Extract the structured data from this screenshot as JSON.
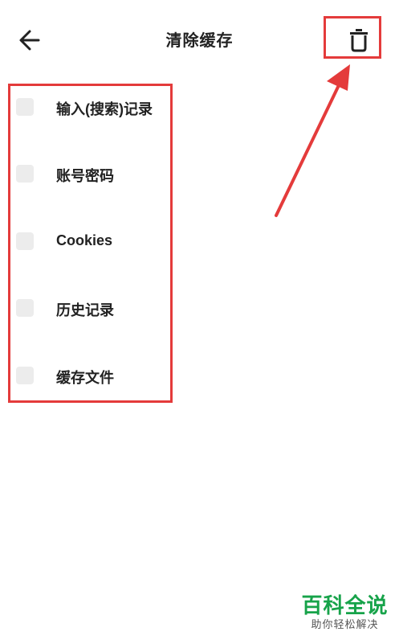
{
  "header": {
    "back_icon": "arrow-left-icon",
    "title": "清除缓存",
    "trash_icon": "trash-icon"
  },
  "list": {
    "items": [
      {
        "label": "输入(搜索)记录",
        "checked": false
      },
      {
        "label": "账号密码",
        "checked": false
      },
      {
        "label": "Cookies",
        "checked": false
      },
      {
        "label": "历史记录",
        "checked": false
      },
      {
        "label": "缓存文件",
        "checked": false
      }
    ]
  },
  "annotation": {
    "color": "#e43b3b"
  },
  "watermark": {
    "main": "百科全说",
    "sub": "助你轻松解决",
    "color": "#17a34a"
  }
}
